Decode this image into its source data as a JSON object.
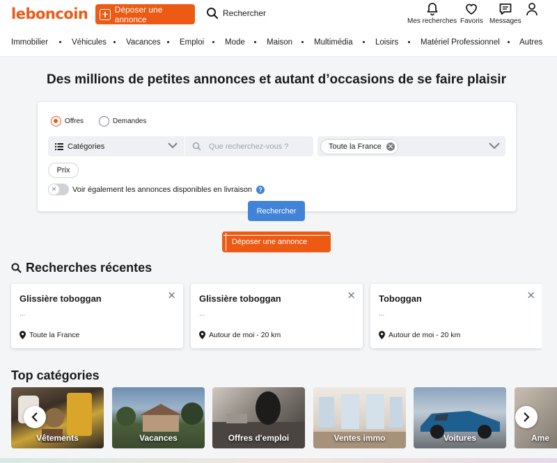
{
  "header": {
    "logo": "leboncoin",
    "post_label": "Déposer une annonce",
    "search_label": "Rechercher",
    "icons": [
      {
        "name": "bell-icon",
        "label": "Mes recherches"
      },
      {
        "name": "heart-icon",
        "label": "Favoris"
      },
      {
        "name": "message-icon",
        "label": "Messages"
      },
      {
        "name": "user-icon",
        "label": ""
      }
    ]
  },
  "nav": {
    "categories": [
      "Immobilier",
      "Véhicules",
      "Vacances",
      "Emploi",
      "Mode",
      "Maison",
      "Multimédia",
      "Loisirs",
      "Matériel Professionnel",
      "Autres"
    ]
  },
  "hero": {
    "title": "Des millions de petites annonces et autant d’occasions de se faire plaisir"
  },
  "search": {
    "radio_offers": "Offres",
    "radio_requests": "Demandes",
    "selected": "Offres",
    "category_label": "Catégories",
    "query_placeholder": "Que recherchez-vous ?",
    "location_chip": "Toute la France",
    "price_label": "Prix",
    "delivery_toggle_label": "Voir également les annonces disponibles en livraison",
    "delivery_toggle_on": false,
    "submit_label": "Rechercher"
  },
  "post_button2": "Déposer une annonce",
  "recent": {
    "title": "Recherches récentes",
    "items": [
      {
        "title": "Glissière toboggan",
        "detail": "...",
        "location": "Toute la France"
      },
      {
        "title": "Glissière toboggan",
        "detail": "...",
        "location": "Autour de moi - 20 km"
      },
      {
        "title": "Toboggan",
        "detail": "...",
        "location": "Autour de moi - 20 km"
      }
    ]
  },
  "top": {
    "title": "Top catégories",
    "items": [
      {
        "label": "Vêtements"
      },
      {
        "label": "Vacances"
      },
      {
        "label": "Offres d'emploi"
      },
      {
        "label": "Ventes immo"
      },
      {
        "label": "Voitures"
      },
      {
        "label": "Ame"
      }
    ]
  },
  "colors": {
    "brand": "#ec5a13",
    "action_blue": "#4183d7"
  }
}
